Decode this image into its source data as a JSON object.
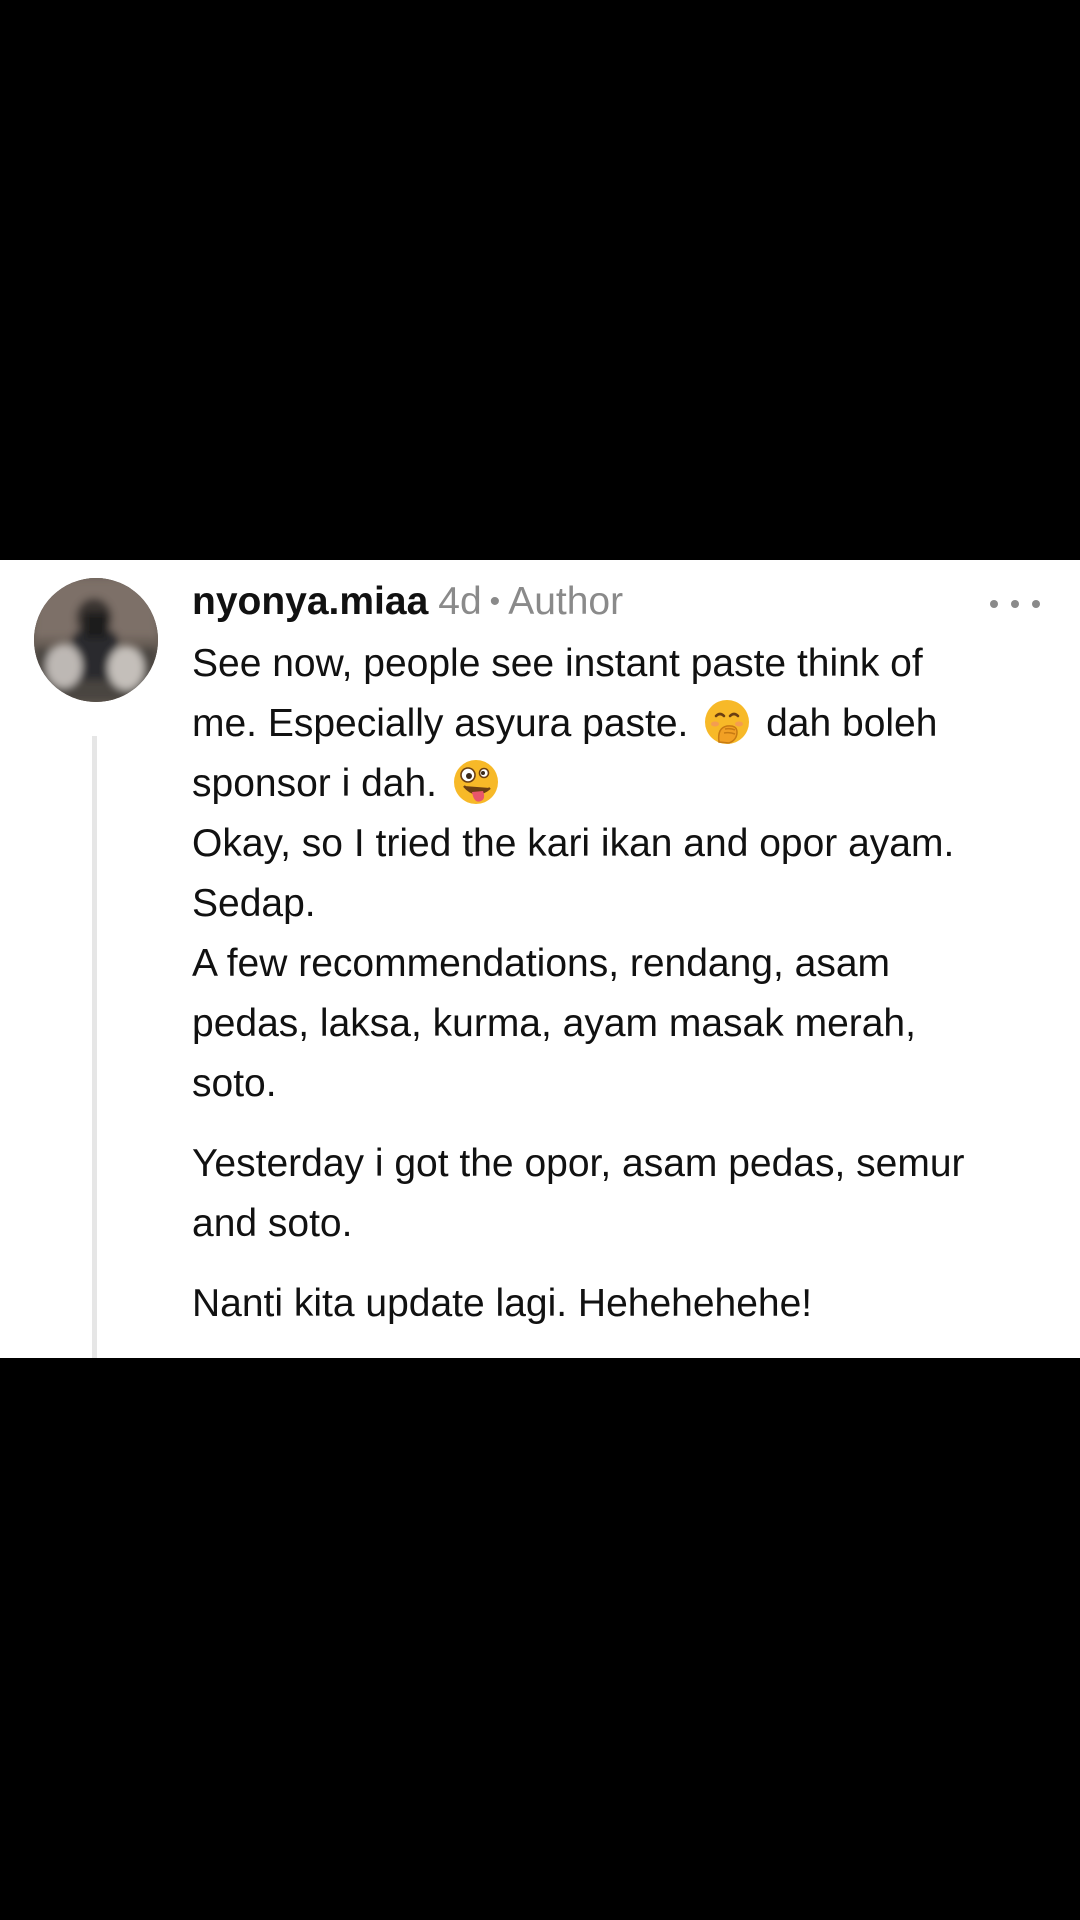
{
  "comment": {
    "username": "nyonya.miaa",
    "time_ago": "4d",
    "separator": "•",
    "role_badge": "Author",
    "paragraph1": {
      "line1": "See now, people see instant paste think of",
      "line2_before_emoji": "me. Especially asyura paste.",
      "emoji1": "face-with-hand-over-mouth-emoji",
      "line2_after_emoji": "dah boleh",
      "line3": "sponsor i dah.",
      "emoji2": "zany-face-emoji",
      "line4": "Okay, so I tried the kari ikan and opor ayam.",
      "line5": "Sedap.",
      "line6": "A few recommendations, rendang, asam",
      "line7": "pedas, laksa, kurma, ayam masak merah,",
      "line8": "soto."
    },
    "paragraph2": {
      "line1": "Yesterday i got the opor, asam pedas, semur",
      "line2": "and soto."
    },
    "paragraph3": {
      "line1": "Nanti kita update lagi. Hehehehehe!"
    },
    "more_icon": "more-horizontal-icon"
  },
  "colors": {
    "background": "#000000",
    "card": "#ffffff",
    "text": "#111111",
    "muted": "#8a8a8a",
    "thread_line": "#e6e6e6",
    "emoji_yellow": "#f7b928"
  }
}
